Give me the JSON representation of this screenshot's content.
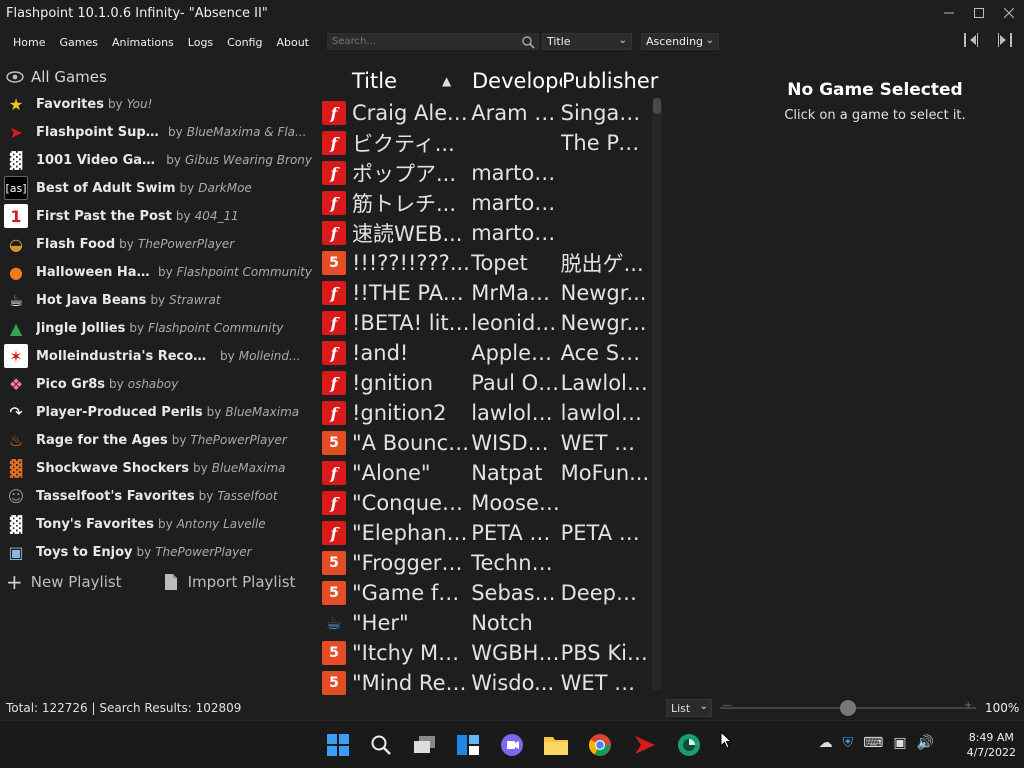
{
  "window": {
    "title": "Flashpoint 10.1.0.6 Infinity- \"Absence II\"",
    "controls": [
      "minimize",
      "maximize",
      "close"
    ]
  },
  "menu": [
    "Home",
    "Games",
    "Animations",
    "Logs",
    "Config",
    "About"
  ],
  "search": {
    "placeholder": "Search...",
    "value": ""
  },
  "sort": {
    "field": "Title",
    "order": "Ascending"
  },
  "sidebar": {
    "all_games": "All Games",
    "playlists": [
      {
        "title": "Favorites",
        "by": "by",
        "author": "You!",
        "icon": "star-icon",
        "color": "#f5c518"
      },
      {
        "title": "Flashpoint Super ...",
        "by": "by",
        "author": "BlueMaxima & Fla...",
        "icon": "flashpoint-icon",
        "color": "#d91a1a"
      },
      {
        "title": "1001 Video Games",
        "by": "by",
        "author": "Gibus Wearing Brony",
        "icon": "space-invader-icon",
        "color": "#ffffff"
      },
      {
        "title": "Best of Adult Swim",
        "by": "by",
        "author": "DarkMoe",
        "icon": "adult-swim-icon",
        "color": "#ffffff"
      },
      {
        "title": "First Past the Post",
        "by": "by",
        "author": "404_11",
        "icon": "first-place-icon",
        "color": "#d91a1a"
      },
      {
        "title": "Flash Food",
        "by": "by",
        "author": "ThePowerPlayer",
        "icon": "burger-icon",
        "color": "#d9932e"
      },
      {
        "title": "Halloween Haunts",
        "by": "by",
        "author": "Flashpoint Community",
        "icon": "pumpkin-icon",
        "color": "#f07c1a"
      },
      {
        "title": "Hot Java Beans",
        "by": "by",
        "author": "Strawrat",
        "icon": "mug-icon",
        "color": "#ffffff"
      },
      {
        "title": "Jingle Jollies",
        "by": "by",
        "author": "Flashpoint Community",
        "icon": "christmas-tree-icon",
        "color": "#2fa84f"
      },
      {
        "title": "Molleindustria's Recomm...",
        "by": "by",
        "author": "Molleind...",
        "icon": "molleindustria-icon",
        "color": "#d91a1a"
      },
      {
        "title": "Pico Gr8s",
        "by": "by",
        "author": "oshaboy",
        "icon": "pico-icon",
        "color": "#ff77a8"
      },
      {
        "title": "Player-Produced Perils",
        "by": "by",
        "author": "BlueMaxima",
        "icon": "share-arrow-icon",
        "color": "#ffffff"
      },
      {
        "title": "Rage for the Ages",
        "by": "by",
        "author": "ThePowerPlayer",
        "icon": "flame-icon",
        "color": "#f06a1a"
      },
      {
        "title": "Shockwave Shockers",
        "by": "by",
        "author": "BlueMaxima",
        "icon": "shockwave-icon",
        "color": "#e07020"
      },
      {
        "title": "Tasselfoot's Favorites",
        "by": "by",
        "author": "Tasselfoot",
        "icon": "avatar-icon",
        "color": "#9a8f80"
      },
      {
        "title": "Tony's Favorites",
        "by": "by",
        "author": "Antony Lavelle",
        "icon": "figure-icon",
        "color": "#ffffff"
      },
      {
        "title": "Toys to Enjoy",
        "by": "by",
        "author": "ThePowerPlayer",
        "icon": "blocks-icon",
        "color": "#8fb4e0"
      }
    ],
    "new_playlist": "New Playlist",
    "import_playlist": "Import Playlist"
  },
  "list": {
    "headers": {
      "title": "Title",
      "developer": "Developer",
      "publisher": "Publisher"
    },
    "rows": [
      {
        "platform": "flash",
        "title": "Craig Alex...",
        "developer": "Aram P...",
        "publisher": "Singap..."
      },
      {
        "platform": "flash",
        "title": "ビクティ...",
        "developer": "",
        "publisher": "The Po..."
      },
      {
        "platform": "flash",
        "title": "ポップア...",
        "developer": "martonn",
        "publisher": ""
      },
      {
        "platform": "flash",
        "title": "筋トレチ...",
        "developer": "martonn",
        "publisher": ""
      },
      {
        "platform": "flash",
        "title": "速読WEB...",
        "developer": "martonn",
        "publisher": ""
      },
      {
        "platform": "html5",
        "title": "!!!??!!???...",
        "developer": "Topet",
        "publisher": "脱出ゲ..."
      },
      {
        "platform": "flash",
        "title": "!!THE PAC...",
        "developer": "MrMan...",
        "publisher": "Newgr..."
      },
      {
        "platform": "flash",
        "title": "!BETA! littl...",
        "developer": "leonido...",
        "publisher": "Newgr..."
      },
      {
        "platform": "flash",
        "title": "!and!",
        "developer": "Apples...",
        "publisher": "Ace Sh..."
      },
      {
        "platform": "flash",
        "title": "!gnition",
        "developer": "Paul Oa...",
        "publisher": "Lawlola..."
      },
      {
        "platform": "flash",
        "title": "!gnition2",
        "developer": "lawlola...",
        "publisher": "lawlola..."
      },
      {
        "platform": "html5",
        "title": "\"A Bounce...",
        "developer": "WISDO...",
        "publisher": "WET G..."
      },
      {
        "platform": "flash",
        "title": "\"Alone\"",
        "developer": "Natpat",
        "publisher": "MoFun..."
      },
      {
        "platform": "flash",
        "title": "\"Conquer ...",
        "developer": "Moose ...",
        "publisher": ""
      },
      {
        "platform": "flash",
        "title": "\"Elephant...",
        "developer": "PETA Ki...",
        "publisher": "PETA Ki..."
      },
      {
        "platform": "html5",
        "title": "\"Frogger\" ...",
        "developer": "Techno...",
        "publisher": ""
      },
      {
        "platform": "html5",
        "title": "\"Game fee...",
        "developer": "Sebasti...",
        "publisher": "Deepni..."
      },
      {
        "platform": "java",
        "title": "\"Her\"",
        "developer": "Notch",
        "publisher": ""
      },
      {
        "platform": "html5",
        "title": "\"Itchy Mar...",
        "developer": "WGBH;...",
        "publisher": "PBS Kids"
      },
      {
        "platform": "html5",
        "title": "\"Mind Rea...",
        "developer": "Wisdo...",
        "publisher": "WET G..."
      }
    ]
  },
  "details": {
    "title": "No Game Selected",
    "subtitle": "Click on a game to select it."
  },
  "status": {
    "counts": "Total: 122726 | Search Results: 102809",
    "view": "List",
    "zoom": "100%",
    "zoom_fraction": 0.5
  },
  "taskbar": {
    "apps": [
      "windows-start-icon",
      "search-icon",
      "task-view-icon",
      "widgets-icon",
      "chat-icon",
      "file-explorer-icon",
      "chrome-icon",
      "flashpoint-icon",
      "edge-dev-icon"
    ],
    "time": "8:49 AM",
    "date": "4/7/2022"
  }
}
